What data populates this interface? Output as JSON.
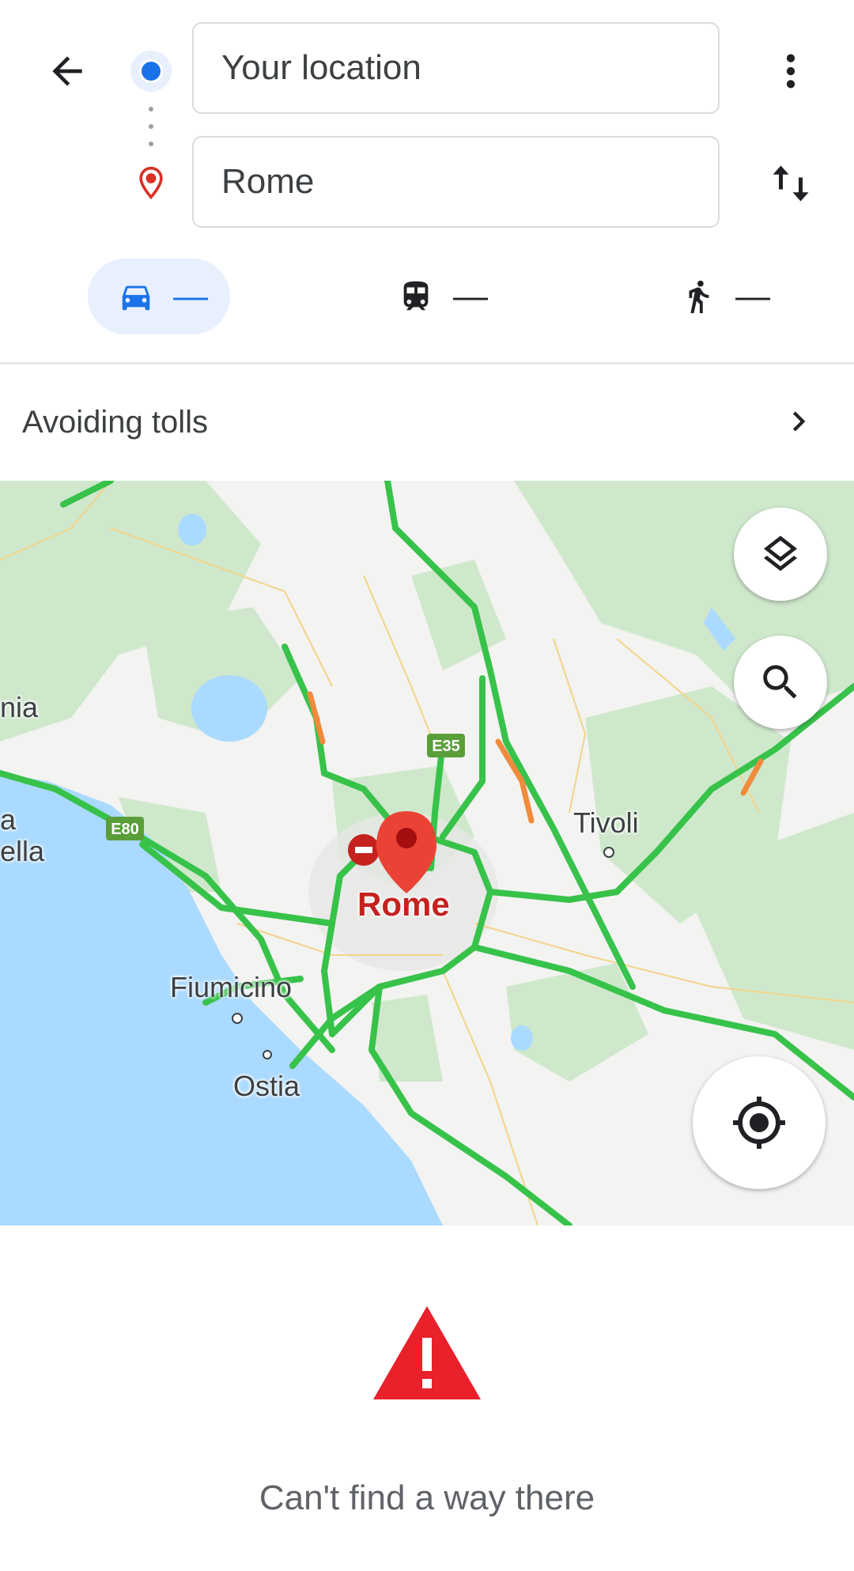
{
  "header": {
    "origin_value": "Your location",
    "destination_value": "Rome"
  },
  "modes": [
    {
      "name": "drive",
      "duration": "—",
      "selected": true
    },
    {
      "name": "transit",
      "duration": "—",
      "selected": false
    },
    {
      "name": "walk",
      "duration": "—",
      "selected": false
    }
  ],
  "options": {
    "avoid_label": "Avoiding tolls"
  },
  "map": {
    "labels": {
      "rome": "Rome",
      "tivoli": "Tivoli",
      "fiumicino": "Fiumicino",
      "ostia": "Ostia",
      "partial_west_1": "nia",
      "partial_west_2": "a",
      "partial_west_3": "ella"
    },
    "shields": {
      "e35": "E35",
      "e80": "E80"
    }
  },
  "status": {
    "message": "Can't find a way there"
  },
  "colors": {
    "accent": "#1a73e8",
    "pin": "#ea4335",
    "road": "#34c759",
    "water": "#aadaff",
    "park": "#c3e6c3",
    "warning": "#e8212b"
  }
}
